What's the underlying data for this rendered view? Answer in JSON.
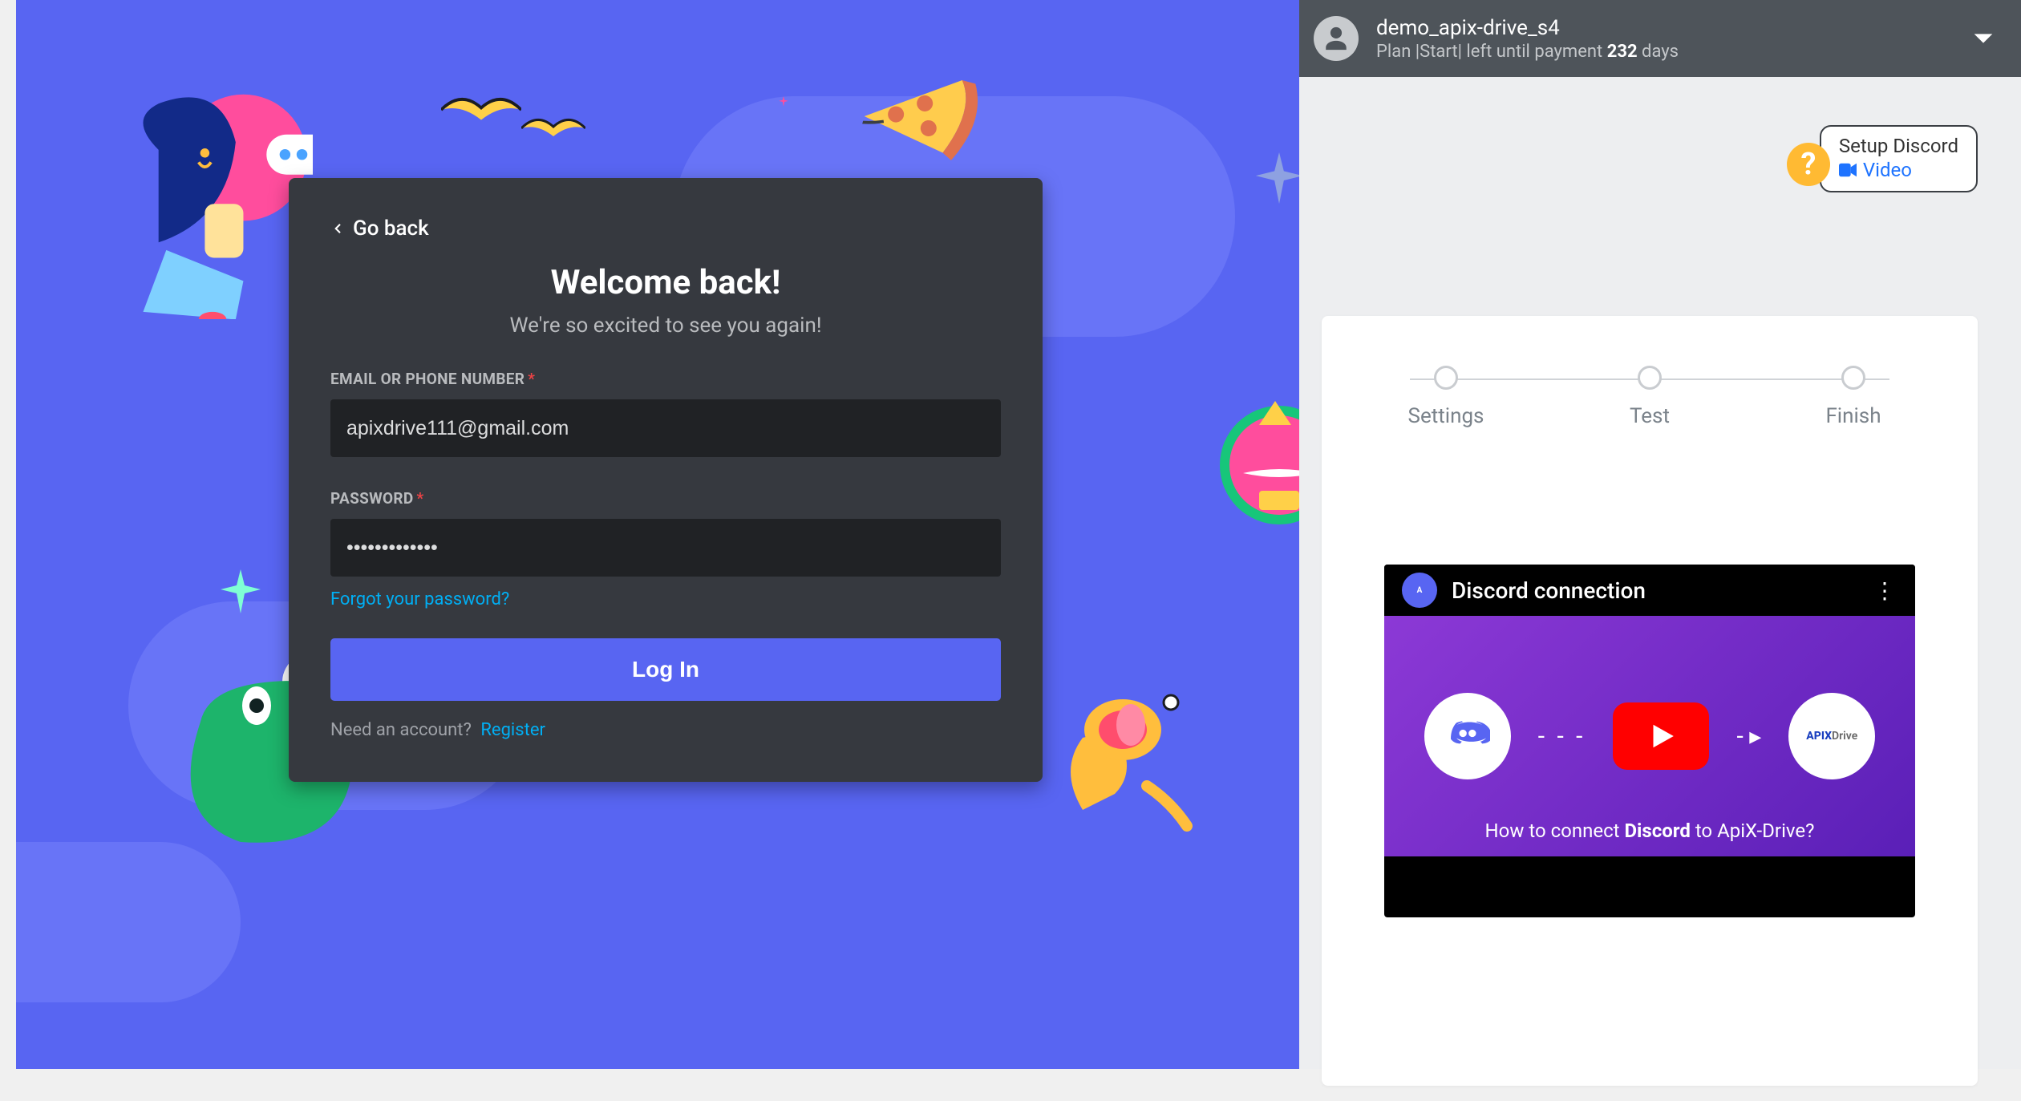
{
  "discord": {
    "go_back": "Go back",
    "title": "Welcome back!",
    "subtitle": "We're so excited to see you again!",
    "email_label": "EMAIL OR PHONE NUMBER",
    "password_label": "PASSWORD",
    "email_value": "apixdrive111@gmail.com",
    "password_value": "•••••••••••••",
    "forgot_link": "Forgot your password?",
    "login_button": "Log In",
    "need_account_text": "Need an account?",
    "register_link": "Register",
    "required_marker": "*"
  },
  "apix": {
    "header": {
      "username": "demo_apix-drive_s4",
      "plan_prefix": "Plan |Start| left until payment ",
      "days_value": "232",
      "days_suffix": " days"
    },
    "setup_box": {
      "title": "Setup Discord",
      "video_label": "Video"
    },
    "help_badge": "?",
    "wizard": {
      "steps": [
        {
          "label": "Settings"
        },
        {
          "label": "Test"
        },
        {
          "label": "Finish"
        }
      ]
    },
    "video": {
      "title": "Discord connection",
      "caption_prefix": "How to connect ",
      "caption_bold": "Discord",
      "caption_suffix": " to ApiX-Drive?",
      "brand1": "APIX",
      "brand2": "Drive"
    }
  }
}
